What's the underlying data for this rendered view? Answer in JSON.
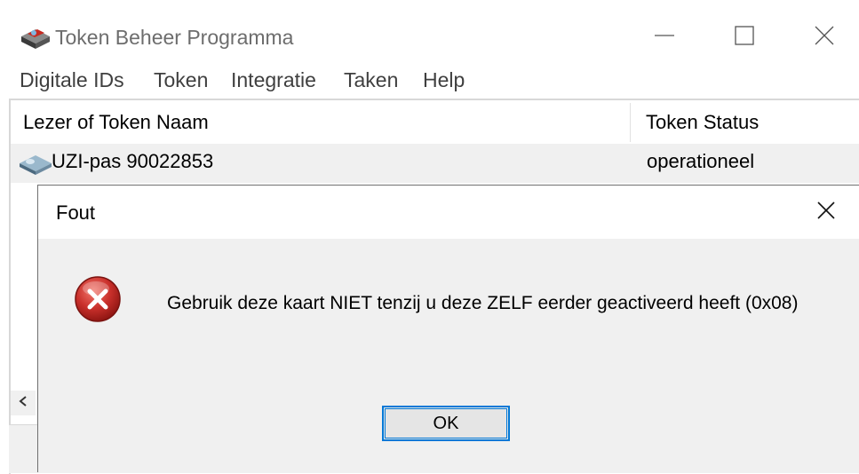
{
  "app": {
    "title": "Token Beheer Programma",
    "icon": "token-app-icon"
  },
  "window_controls": {
    "minimize_icon": "minimize-icon",
    "maximize_icon": "maximize-icon",
    "close_icon": "close-icon"
  },
  "menu": {
    "items": [
      "Digitale IDs",
      "Token",
      "Integratie",
      "Taken",
      "Help"
    ]
  },
  "list": {
    "columns": [
      "Lezer of Token Naam",
      "Token Status"
    ],
    "rows": [
      {
        "name": "UZI-pas 90022853",
        "status": "operationeel",
        "icon": "smart-card-icon"
      }
    ],
    "scroll_left_icon": "chevron-left-icon"
  },
  "dialog": {
    "title": "Fout",
    "message": "Gebruik deze kaart NIET tenzij u deze ZELF eerder geactiveerd heeft (0x08)",
    "ok_label": "OK",
    "icon": "error-icon",
    "close_icon": "close-icon"
  },
  "colors": {
    "accent": "#0078d7",
    "error_red": "#c0272d",
    "dialog_bg": "#f0f0f0",
    "row_bg": "#f0f0f0"
  }
}
